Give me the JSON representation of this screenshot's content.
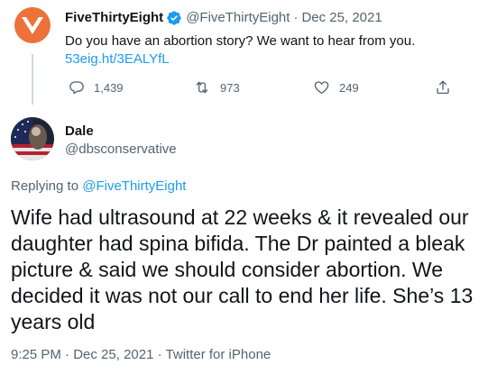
{
  "parent_tweet": {
    "author_name": "FiveThirtyEight",
    "handle": "@FiveThirtyEight",
    "separator": "·",
    "date": "Dec 25, 2021",
    "text": "Do you have an abortion story? We want to hear from you.",
    "link": "53eig.ht/3EALYfL",
    "actions": {
      "replies": "1,439",
      "retweets": "973",
      "likes": "249"
    },
    "avatar_icon": "fivethirtyeight-logo-icon",
    "avatar_colors": {
      "background": "#ed713a",
      "mark": "#ffffff"
    }
  },
  "reply_tweet": {
    "author_name": "Dale",
    "handle": "@dbsconservative",
    "replying_prefix": "Replying to",
    "replying_to": "@FiveThirtyEight",
    "text": "Wife had ultrasound at 22 weeks & it revealed our daughter had spina bifida. The Dr painted a bleak picture & said we should consider abortion. We decided it was not our call to end her life. She’s 13 years old",
    "time": "9:25 PM",
    "separator": "·",
    "date": "Dec 25, 2021",
    "source": "Twitter for iPhone"
  },
  "icons": {
    "verified": "verified-badge-icon",
    "reply": "reply-icon",
    "retweet": "retweet-icon",
    "like": "heart-icon",
    "share": "share-icon"
  },
  "colors": {
    "link": "#1d9bf0",
    "text": "#0f1419",
    "muted": "#536471",
    "thread_line": "#cfd9de"
  }
}
